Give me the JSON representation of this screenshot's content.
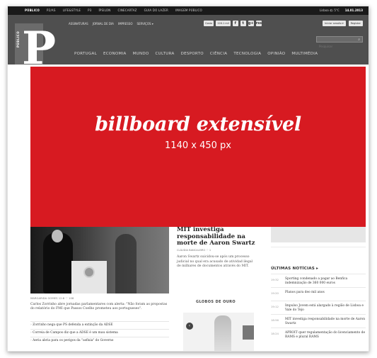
{
  "topbar": {
    "nav": [
      "PÚBLICO",
      "P2/AS",
      "LIFE&STYLE",
      "P3",
      "ÍPSILON",
      "CINECARTAZ",
      "GUIA DO LAZER",
      "IMAGEM PÚBLICO"
    ],
    "lisboa": "Lisboa 🌤 5°C",
    "date": "14.01.2013"
  },
  "header": {
    "logo_letter": "P",
    "logo_word": "PÚBLICO",
    "subnav": [
      "ASSINATURAS",
      "JORNAL DE DIA",
      "IMPRESSO",
      "SERVIÇOS ▾"
    ],
    "social": {
      "pill1": "Gosto",
      "pill2": "126.1 mil",
      "icons": [
        "f",
        "t",
        "g+",
        "rss"
      ]
    },
    "auth": {
      "login": "Iniciar sessão ▾",
      "register": "Registar"
    },
    "search_placeholder": "Pesquisar",
    "mainnav": [
      "PORTUGAL",
      "ECONOMIA",
      "MUNDO",
      "CULTURA",
      "DESPORTO",
      "CIÊNCIA",
      "TECNOLOGIA",
      "OPINIÃO",
      "MULTIMÉDIA"
    ]
  },
  "billboard": {
    "title": "billboard extensível",
    "size": "1140 x 450 px"
  },
  "main_story": {
    "meta": "MARGARIDA GOMES    12:8    ♡ 108",
    "lede": "Carlos Zorrinho abre jornadas parlamentares com alerta: \"Não foram as propostas do relatório do FMI que Passos Coelho prometeu aos portugueses\".",
    "related": [
      "Zorrinho nega que PS defenda a extinção da ADSE",
      "Correia de Campos diz que a ADSE é um mau sistema",
      "Aeria abria para os perigos da \"asfixia\" do Governo"
    ]
  },
  "mid_story": {
    "headline": "MIT investiga responsabilidade na morte de Aaron Swartz",
    "meta": "CLÁUDIA BANCALEIRO    ♡ 1",
    "text": "Aaron Swartz suicidou-se após um processo judicial no qual era acusado de atividad ilegal de milhares de documentos através do MIT.",
    "section": "GLOBOS DE OURO"
  },
  "sidebar": {
    "ultimas_title": "ÚLTIMAS NOTÍCIAS ▸",
    "news": [
      {
        "time": "19:32",
        "text": "Sporting condenado a pagar ao Benfica indemnização de 360 000 euros"
      },
      {
        "time": "19:20",
        "text": "Planos para deo mil anos"
      },
      {
        "time": "19:12",
        "text": "Impulso Jovem está alargado à região de Lisboa e Vale do Tejo"
      },
      {
        "time": "18:56",
        "text": "MIT investiga responsabilidade na morte de Aaron Swartz"
      },
      {
        "time": "18:24",
        "text": "APROIT quer regulamentação do licenciamento de RAMS e plural RAMS"
      }
    ]
  },
  "colors": {
    "billboard_red": "#d71a21",
    "header_gray": "#4f4f4f",
    "topbar_black": "#1a1a1a"
  }
}
